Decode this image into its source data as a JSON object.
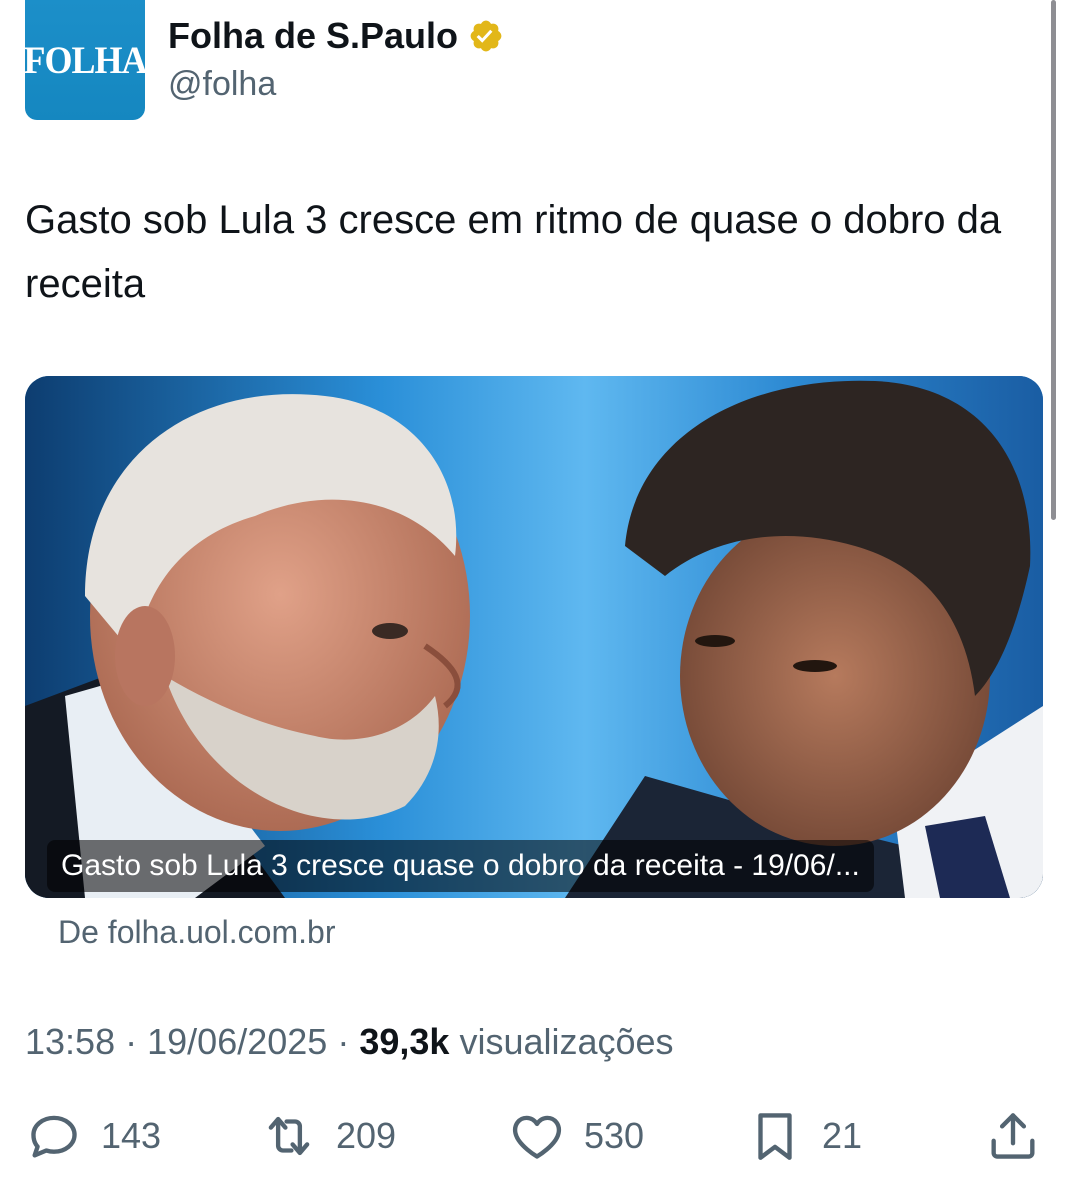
{
  "account": {
    "avatar_text": "FOLHA",
    "display_name": "Folha de S.Paulo",
    "handle": "@folha",
    "verified_icon": "verified-gold-badge-icon"
  },
  "tweet": {
    "text": "Gasto sob Lula 3 cresce em ritmo de quase o dobro da receita"
  },
  "card": {
    "caption": "Gasto sob Lula 3 cresce quase o dobro da receita - 19/06/...",
    "source": "De folha.uol.com.br"
  },
  "meta": {
    "time": "13:58",
    "separator": "·",
    "date": "19/06/2025",
    "views_count": "39,3k",
    "views_label": "visualizações"
  },
  "actions": {
    "replies": "143",
    "reposts": "209",
    "likes": "530",
    "bookmarks": "21"
  },
  "colors": {
    "text_primary": "#0f1419",
    "text_secondary": "#536471",
    "avatar_bg": "#1587c0",
    "verified_gold": "#e2b719"
  }
}
